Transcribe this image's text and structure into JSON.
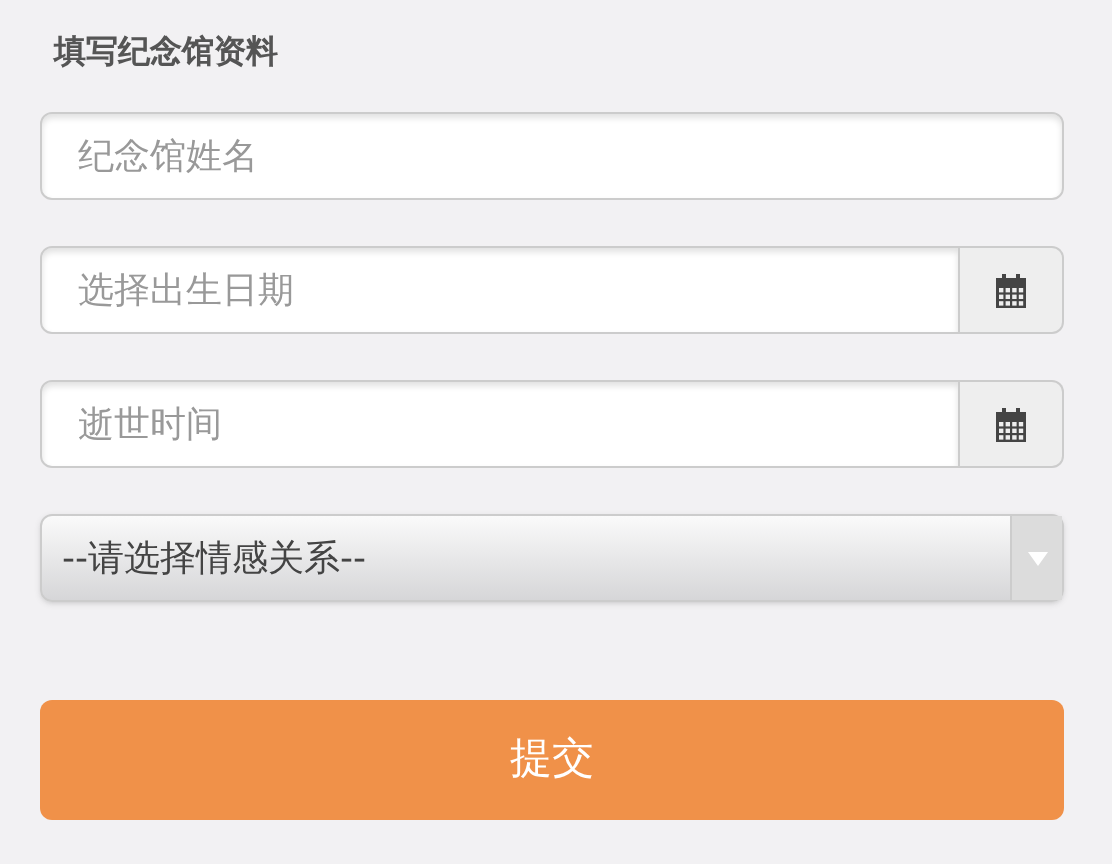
{
  "title": "填写纪念馆资料",
  "fields": [
    {
      "kind": "text",
      "placeholder": "纪念馆姓名"
    },
    {
      "kind": "date",
      "placeholder": "选择出生日期"
    },
    {
      "kind": "date",
      "placeholder": "逝世时间"
    },
    {
      "kind": "select",
      "value": "--请选择情感关系--"
    }
  ],
  "submit": "提交"
}
